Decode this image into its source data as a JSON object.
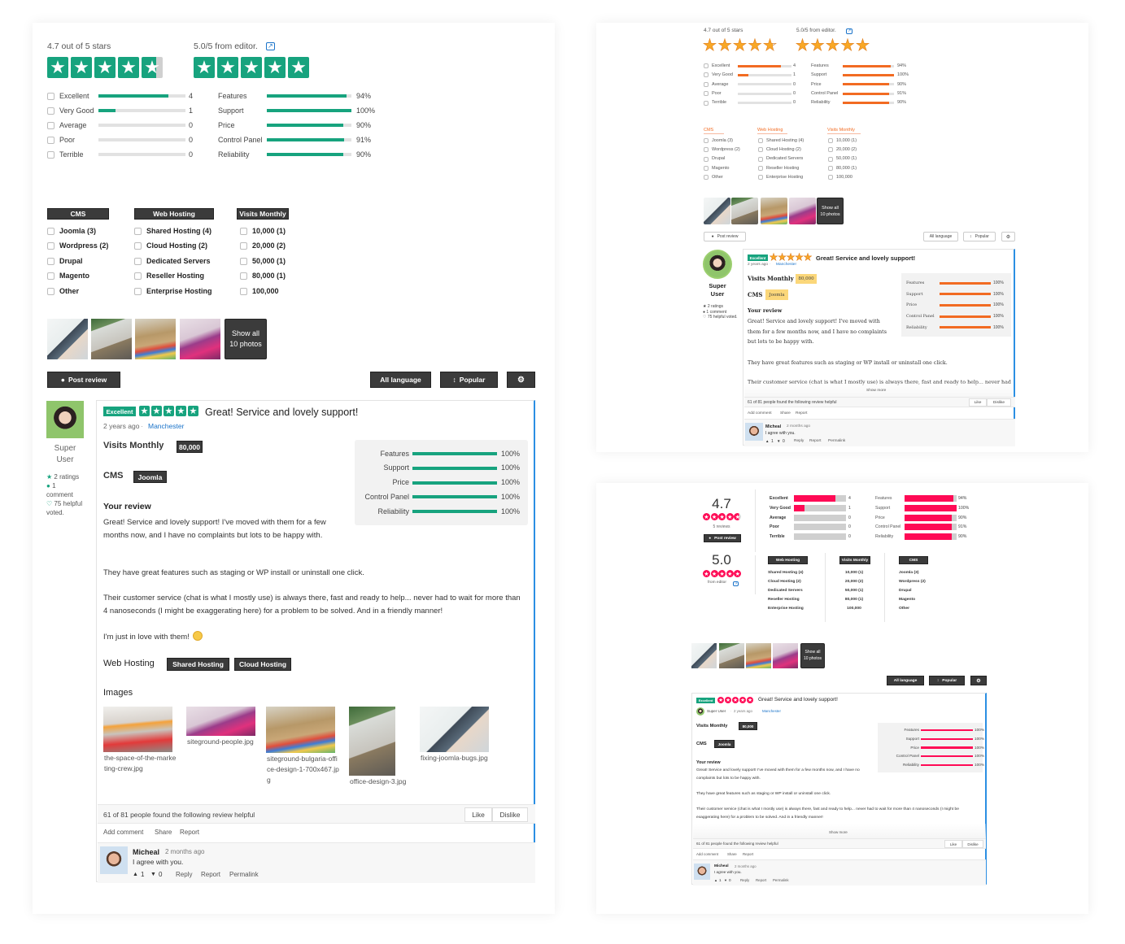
{
  "colors": {
    "green": "#17a37e",
    "orange": "#f26b22",
    "pink": "#ff0a55",
    "dark": "#3b3b3b",
    "accent_blue": "#2b8fe3",
    "link": "#1a73c9",
    "highlight_yellow": "#fbd77a"
  },
  "summary": {
    "user_rating_label": "4.7 out of 5 stars",
    "user_rating": 4.7,
    "editor_rating_label": "5.0/5 from editor.",
    "editor_rating": 5.0,
    "user_score": "4.7",
    "editor_score": "5.0",
    "reviews_count": "5 reviews",
    "from_editor": "from editor",
    "external_link_icon": "external-link-icon"
  },
  "distribution": [
    {
      "label": "Excellent",
      "count": 4
    },
    {
      "label": "Very Good",
      "count": 1
    },
    {
      "label": "Average",
      "count": 0
    },
    {
      "label": "Poor",
      "count": 0
    },
    {
      "label": "Terrible",
      "count": 0
    }
  ],
  "criteria": [
    {
      "label": "Features",
      "value": 94
    },
    {
      "label": "Support",
      "value": 100
    },
    {
      "label": "Price",
      "value": 90
    },
    {
      "label": "Control Panel",
      "value": 91
    },
    {
      "label": "Reliability",
      "value": 90
    }
  ],
  "filters": {
    "cms": {
      "title": "CMS",
      "items": [
        "Joomla (3)",
        "Wordpress (2)",
        "Drupal",
        "Magento",
        "Other"
      ]
    },
    "web_hosting": {
      "title": "Web Hosting",
      "items": [
        "Shared Hosting (4)",
        "Cloud Hosting (2)",
        "Dedicated Servers",
        "Reseller Hosting",
        "Enterprise Hosting"
      ]
    },
    "visits": {
      "title": "Visits Monthly",
      "items": [
        "10,000 (1)",
        "20,000 (2)",
        "50,000 (1)",
        "80,000 (1)",
        "100,000"
      ]
    }
  },
  "photos": {
    "show_all": "Show all 10 photos"
  },
  "toolbar": {
    "post_review": "Post review",
    "language": "All language",
    "sort": "Popular"
  },
  "review": {
    "badge": "Excellent",
    "rating": 5,
    "title": "Great! Service and lovely support!",
    "time": "2 years ago",
    "separator": "·",
    "location": "Manchester",
    "user": "Super User",
    "stats": {
      "ratings": "2 ratings",
      "comments": "1 comment",
      "helpful": "75 helpful voted."
    },
    "fields": {
      "visits_label": "Visits Monthly",
      "visits_value": "80,000",
      "cms_label": "CMS",
      "cms_value": "Joomla",
      "hosting_label": "Web Hosting",
      "hosting_values": [
        "Shared Hosting",
        "Cloud Hosting"
      ]
    },
    "criteria": [
      {
        "label": "Features",
        "value": 100
      },
      {
        "label": "Support",
        "value": 100
      },
      {
        "label": "Price",
        "value": 100
      },
      {
        "label": "Control Panel",
        "value": 100
      },
      {
        "label": "Reliability",
        "value": 100
      }
    ],
    "your_review": "Your review",
    "paragraphs": [
      "Great! Service and lovely support! I've moved with them for a few months now, and I have no complaints but lots to be happy with.",
      "They have great features such as staging or WP install or uninstall one click.",
      "Their customer service (chat is what I mostly use) is always there, fast and ready to help... never had to wait for more than 4 nanoseconds (I might be exaggerating here) for a problem to be solved. And in a friendly manner!",
      "I'm just in love with them!"
    ],
    "images_label": "Images",
    "images": [
      "the-space-of-the-marketing-crew.jpg",
      "siteground-people.jpg",
      "siteground-bulgaria-office-design-1-700x467.jpg",
      "office-design-3.jpg",
      "fixing-joomla-bugs.jpg"
    ],
    "show_more": "Show more",
    "helpful_text": "61 of 81 people found the following review helpful",
    "like": "Like",
    "dislike": "Dislike",
    "actions": [
      "Add comment",
      "Share",
      "Report"
    ],
    "comment": {
      "author": "Micheal",
      "time": "2 months ago",
      "text": "I agree with you.",
      "likes": "1",
      "dislikes": "0",
      "actions": [
        "Reply",
        "Report",
        "Permalink"
      ]
    }
  }
}
